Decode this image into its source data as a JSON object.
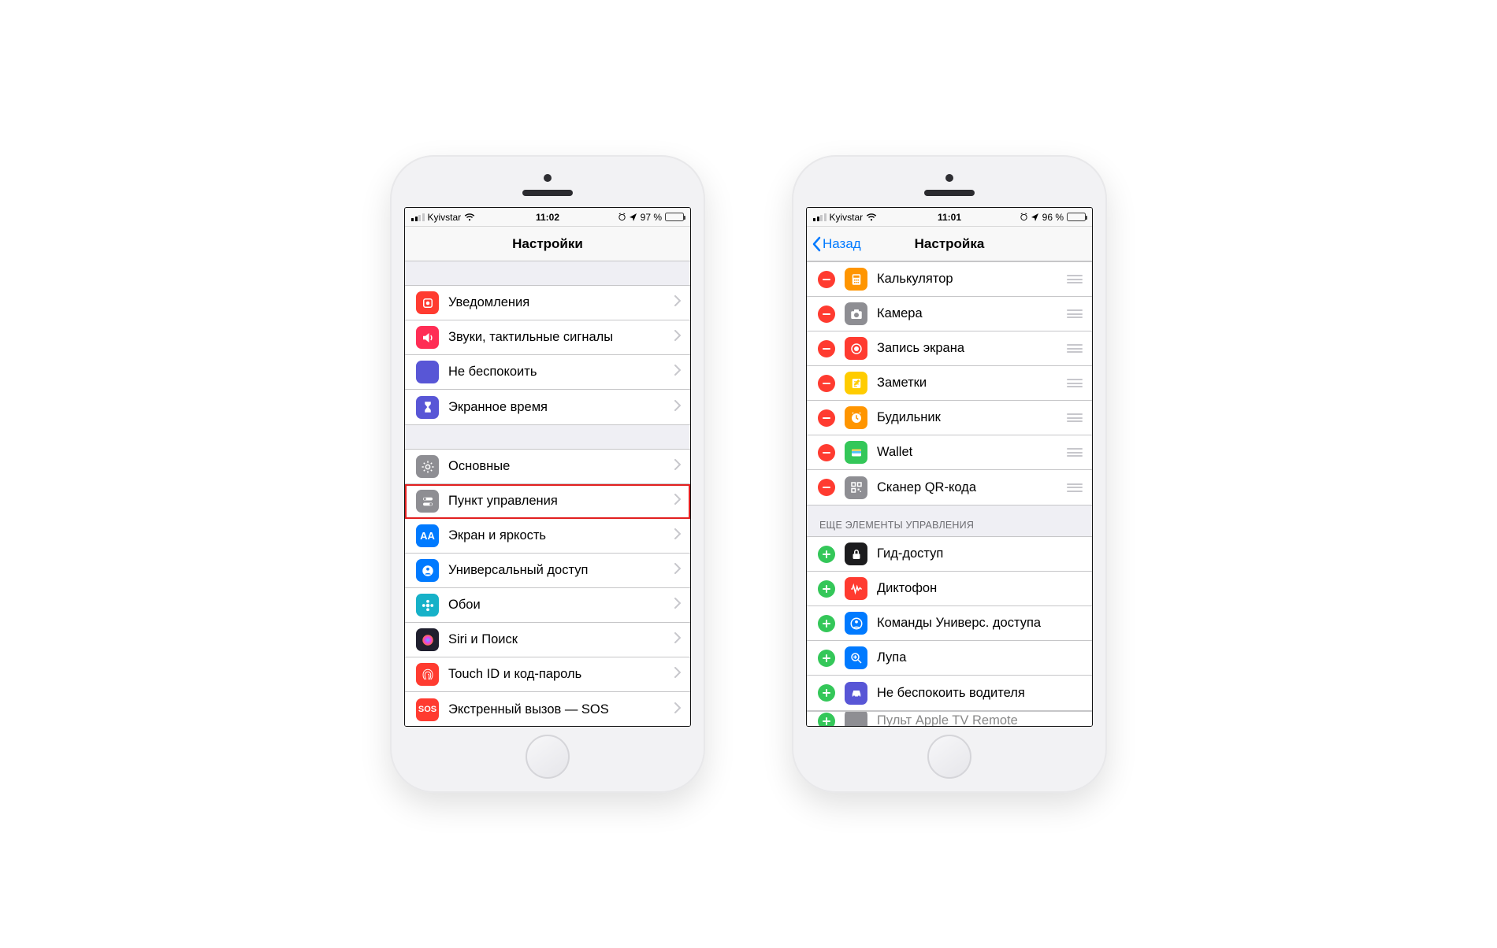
{
  "left": {
    "status": {
      "carrier": "Kyivstar",
      "time": "11:02",
      "battery": "97 %"
    },
    "title": "Настройки",
    "group1": [
      {
        "id": "notifications",
        "label": "Уведомления",
        "bg": "#ff3b30",
        "glyph": "bell"
      },
      {
        "id": "sounds",
        "label": "Звуки, тактильные сигналы",
        "bg": "#ff2d55",
        "glyph": "speaker"
      },
      {
        "id": "dnd",
        "label": "Не беспокоить",
        "bg": "#5856d6",
        "glyph": "moon"
      },
      {
        "id": "screentime",
        "label": "Экранное время",
        "bg": "#5856d6",
        "glyph": "hourglass"
      }
    ],
    "group2": [
      {
        "id": "general",
        "label": "Основные",
        "bg": "#8e8e93",
        "glyph": "gear"
      },
      {
        "id": "control-center",
        "label": "Пункт управления",
        "bg": "#8e8e93",
        "glyph": "toggles",
        "highlight": true
      },
      {
        "id": "display",
        "label": "Экран и яркость",
        "bg": "#007aff",
        "glyph": "aa"
      },
      {
        "id": "accessibility",
        "label": "Универсальный доступ",
        "bg": "#007aff",
        "glyph": "person"
      },
      {
        "id": "wallpaper",
        "label": "Обои",
        "bg": "#16b1c8",
        "glyph": "flower"
      },
      {
        "id": "siri",
        "label": "Siri и Поиск",
        "bg": "#1f1f2e",
        "glyph": "siri"
      },
      {
        "id": "touchid",
        "label": "Touch ID и код-пароль",
        "bg": "#ff3b30",
        "glyph": "finger"
      },
      {
        "id": "sos",
        "label": "Экстренный вызов — SOS",
        "bg": "#ff3b30",
        "glyph": "sos"
      }
    ]
  },
  "right": {
    "status": {
      "carrier": "Kyivstar",
      "time": "11:01",
      "battery": "96 %"
    },
    "back": "Назад",
    "title": "Настройка",
    "included": [
      {
        "id": "calculator",
        "label": "Калькулятор",
        "bg": "#ff9500",
        "glyph": "calc"
      },
      {
        "id": "camera",
        "label": "Камера",
        "bg": "#8e8e93",
        "glyph": "camera"
      },
      {
        "id": "screenrec",
        "label": "Запись экрана",
        "bg": "#ff3b30",
        "glyph": "rec"
      },
      {
        "id": "notes",
        "label": "Заметки",
        "bg": "#ffcc00",
        "glyph": "note"
      },
      {
        "id": "alarm",
        "label": "Будильник",
        "bg": "#ff9500",
        "glyph": "clock"
      },
      {
        "id": "wallet",
        "label": "Wallet",
        "bg": "#34c759",
        "glyph": "wallet"
      },
      {
        "id": "qr",
        "label": "Сканер QR-кода",
        "bg": "#8e8e93",
        "glyph": "qr"
      }
    ],
    "more_header": "ЕЩЕ ЭЛЕМЕНТЫ УПРАВЛЕНИЯ",
    "more": [
      {
        "id": "guided",
        "label": "Гид-доступ",
        "bg": "#1c1c1e",
        "glyph": "lock"
      },
      {
        "id": "voice",
        "label": "Диктофон",
        "bg": "#ff3b30",
        "glyph": "wave"
      },
      {
        "id": "shortcuts",
        "label": "Команды Универс. доступа",
        "bg": "#007aff",
        "glyph": "personcirc"
      },
      {
        "id": "magnifier",
        "label": "Лупа",
        "bg": "#007aff",
        "glyph": "zoom"
      },
      {
        "id": "dnd-drive",
        "label": "Не беспокоить водителя",
        "bg": "#5856d6",
        "glyph": "car"
      }
    ],
    "peek": {
      "label": "Пульт Apple TV Remote",
      "bg": "#8e8e93"
    }
  }
}
